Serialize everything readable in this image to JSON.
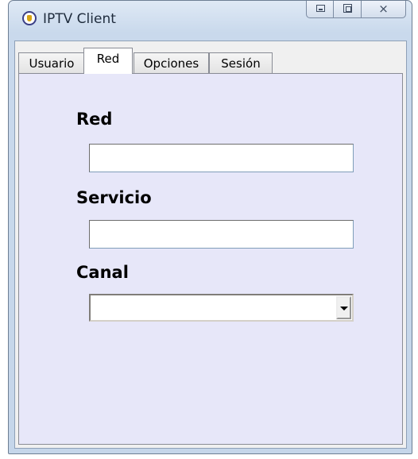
{
  "window": {
    "title": "IPTV Client",
    "close_glyph": "⨯"
  },
  "tabs": [
    {
      "label": "Usuario"
    },
    {
      "label": "Red"
    },
    {
      "label": "Opciones"
    },
    {
      "label": "Sesión"
    }
  ],
  "active_tab": "Red",
  "form": {
    "red": {
      "label": "Red",
      "value": ""
    },
    "servicio": {
      "label": "Servicio",
      "value": ""
    },
    "canal": {
      "label": "Canal",
      "selected": ""
    }
  },
  "colors": {
    "panel_background": "#e7e7f9",
    "titlebar": "#c9d9ec"
  }
}
